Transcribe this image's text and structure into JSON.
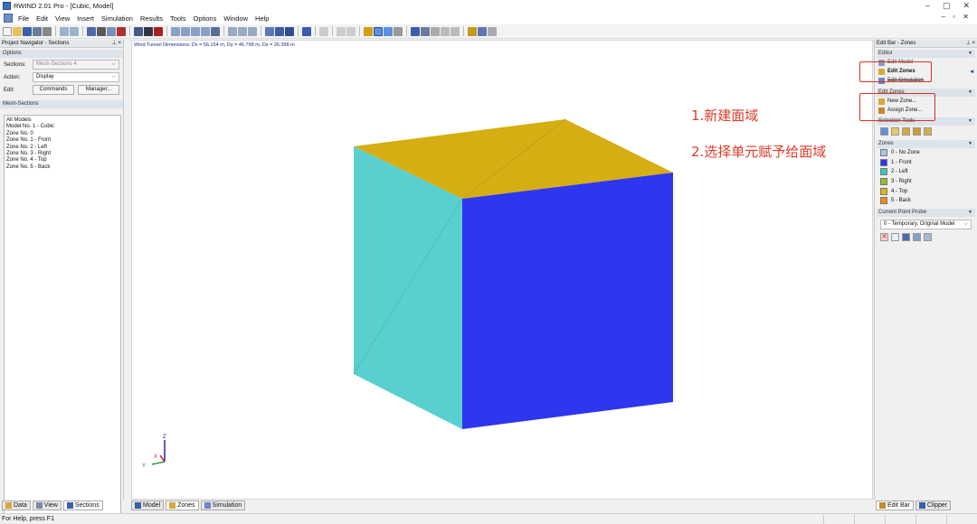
{
  "window": {
    "title": "RWIND 2.01 Pro - [Cubic, Model]",
    "minimize": "–",
    "restore": "▢",
    "close": "✕"
  },
  "menu": [
    "File",
    "Edit",
    "View",
    "Insert",
    "Simulation",
    "Results",
    "Tools",
    "Options",
    "Window",
    "Help"
  ],
  "mdi_controls": "– ▫ ✕",
  "navigator": {
    "title": "Project Navigator - Sections",
    "pin": "⊥ ×",
    "options_header": "Options",
    "sections_label": "Sections:",
    "sections_value": "Mesh-Sections 4",
    "action_label": "Action:",
    "action_value": "Display",
    "edit_label": "Edit:",
    "commands_button": "Commands",
    "manager_button": "Manager...",
    "mesh_header": "Mesh-Sections",
    "tree": [
      "All Models",
      "Model No. 1 - Cubic",
      "Zone No. 0",
      "Zone No. 1 - Front",
      "Zone No. 2 - Left",
      "Zone No. 3 - Right",
      "Zone No. 4 - Top",
      "Zone No. 5 - Back"
    ]
  },
  "nav_tabs": [
    "Data",
    "View",
    "Sections"
  ],
  "viewport": {
    "dimensions": "Wind Tunnel Dimensions: Dx = 56.154 m, Dy = 46.798 m, Dz = 26.398 m",
    "colors": {
      "top": "#d4ae12",
      "left": "#5acfcf",
      "front": "#2e36f0"
    },
    "axes": {
      "x": "X",
      "y": "Y",
      "z": "Z"
    }
  },
  "annotations": {
    "step1": "1.新建面域",
    "step2": "2.选择单元赋予给面域"
  },
  "view_tabs": [
    "Model",
    "Zones",
    "Simulation"
  ],
  "editbar": {
    "title": "Edit Bar - Zones",
    "pin": "⊥ ×",
    "editor_header": "Editor",
    "edit_model": "Edit Model",
    "edit_zones": "Edit Zones",
    "edit_simulation": "Edit Simulation",
    "edit_zones_header": "Edit Zones",
    "new_zone": "New Zone...",
    "assign_zone": "Assign Zone...",
    "selection_tools_header": "Selection Tools",
    "zones_header": "Zones",
    "zones": [
      {
        "label": "0 - No Zone",
        "color": "#a9c4e8"
      },
      {
        "label": "1 - Front",
        "color": "#2e36f0"
      },
      {
        "label": "2 - Left",
        "color": "#35c7c1"
      },
      {
        "label": "3 - Right",
        "color": "#8fbf2a"
      },
      {
        "label": "4 - Top",
        "color": "#e0b417"
      },
      {
        "label": "5 - Back",
        "color": "#ef8a18"
      }
    ],
    "probe_header": "Current Point Probe",
    "probe_value": "0 - Temporary, Original Model"
  },
  "editbar_tabs": [
    "Edit Bar",
    "Clipper"
  ],
  "status": "For Help, press F1"
}
